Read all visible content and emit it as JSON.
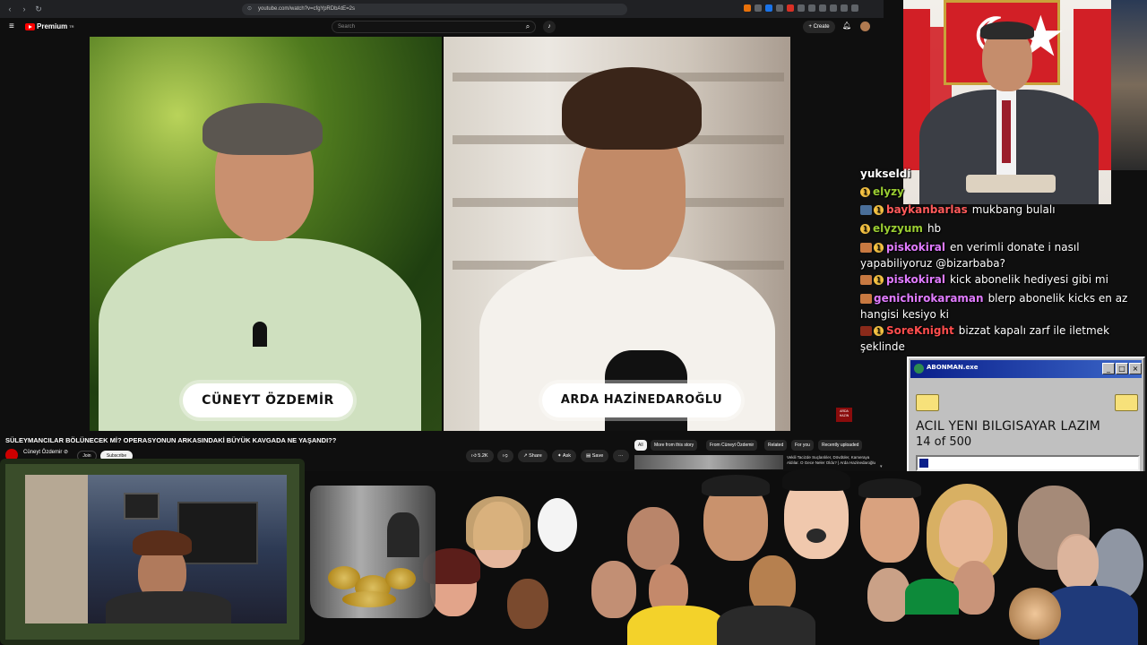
{
  "browser": {
    "url": "youtube.com/watch?v=cfgYpRDbAtE=2s"
  },
  "youtube": {
    "logo_text": "Premium",
    "logo_sup": "TR",
    "search_placeholder": "Search",
    "create_label": "+ Create"
  },
  "video": {
    "left_name": "CÜNEYT ÖZDEMİR",
    "right_name": "ARDA HAZİNEDAROĞLU",
    "title": "SÜLEYMANCILAR BÖLÜNECEK Mİ? OPERASYONUN ARKASINDAKİ BÜYÜK KAVGADA NE YAŞANDI??",
    "channel": "Cüneyt Özdemir ⊘",
    "join_label": "Join",
    "subscribe_label": "Subscribe",
    "likes": "5.2K",
    "share_label": "Share",
    "ask_label": "Ask",
    "save_label": "Save",
    "more_label": "···",
    "side_logo": "ARDA HAZIN"
  },
  "filters": [
    {
      "label": "All"
    },
    {
      "label": "More from this story"
    },
    {
      "label": "From Cüneyt Özdemir"
    },
    {
      "label": "Related"
    },
    {
      "label": "For you"
    },
    {
      "label": "Recently uploaded"
    }
  ],
  "related": {
    "title": "Vekili Tacizde Suçlanlıler, Dövdüler, Kameraya Aldılar. O Gece Neler Oldu? | Arda Hazinedaroğlu"
  },
  "chat": [
    {
      "user": "yukseldi",
      "text": "",
      "user_color": "#ffffff"
    },
    {
      "user": "elyzy",
      "text": "",
      "user_color": "#9acd32"
    },
    {
      "user": "baykanbarlas",
      "text": "mukbang bulalı",
      "user_color": "#ff5a5a"
    },
    {
      "user": "elyzyum",
      "text": "hb",
      "user_color": "#9acd32"
    },
    {
      "user": "piskokiral",
      "text": "en verimli donate i nasıl yapabiliyoruz @bizarbaba?",
      "user_color": "#e07bff"
    },
    {
      "user": "piskokiral",
      "text": "kick abonelik hediyesi gibi mi",
      "user_color": "#e07bff"
    },
    {
      "user": "genichirokaraman",
      "text": "blerp abonelik kicks en az hangisi kesiyo ki",
      "user_color": "#e07bff"
    },
    {
      "user": "SoreKnight",
      "text": "bizzat kapalı zarf ile iletmek şeklinde",
      "user_color": "#ff4d4d"
    }
  ],
  "retro_window": {
    "title": "ABONMAN.exe",
    "heading": "ACIL YENI BILGISAYAR LAZIM",
    "count": "14 of 500",
    "progress": 0.028
  },
  "colors": {
    "accent": "#ff0000",
    "retro_title": "#0a1f8a"
  }
}
